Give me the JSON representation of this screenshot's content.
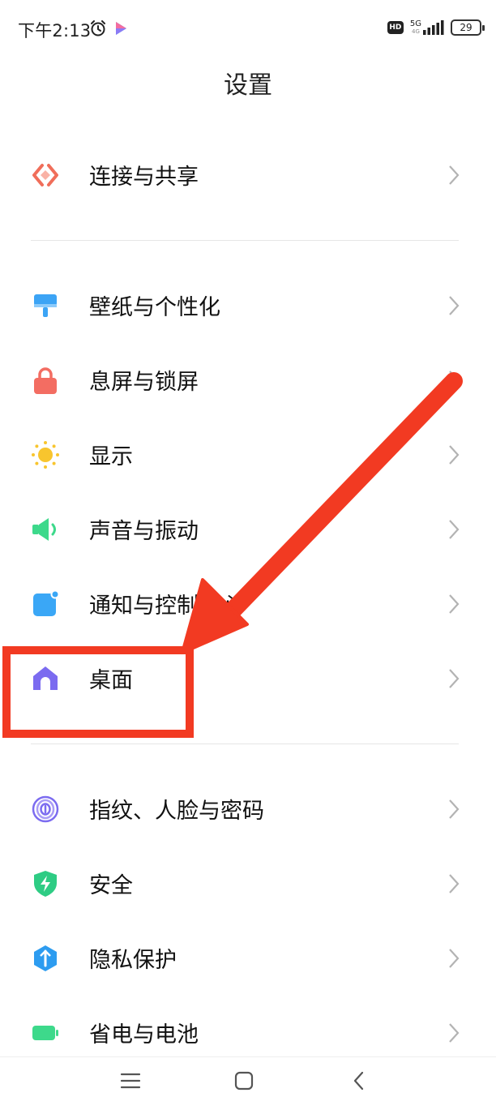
{
  "status_bar": {
    "time": "下午2:13",
    "network_type": "5G",
    "network_sub": "4G",
    "hd_badge": "HD",
    "battery": "29"
  },
  "header": {
    "title": "设置"
  },
  "sections": [
    {
      "items": [
        {
          "label": "连接与共享",
          "icon": "share-connect-icon",
          "color": "#F06E5A"
        }
      ]
    },
    {
      "items": [
        {
          "label": "壁纸与个性化",
          "icon": "wallpaper-brush-icon",
          "color": "#3CA4F5"
        },
        {
          "label": "息屏与锁屏",
          "icon": "lock-icon",
          "color": "#F36D62"
        },
        {
          "label": "显示",
          "icon": "sun-icon",
          "color": "#F8C52E"
        },
        {
          "label": "声音与振动",
          "icon": "speaker-icon",
          "color": "#3DD98B"
        },
        {
          "label": "通知与控制中心",
          "icon": "notification-icon",
          "color": "#3AA7F6"
        },
        {
          "label": "桌面",
          "icon": "home-icon",
          "color": "#7B6BF0"
        }
      ]
    },
    {
      "items": [
        {
          "label": "指纹、人脸与密码",
          "icon": "fingerprint-icon",
          "color": "#7C6CF0"
        },
        {
          "label": "安全",
          "icon": "shield-bolt-icon",
          "color": "#2ECC84"
        },
        {
          "label": "隐私保护",
          "icon": "privacy-icon",
          "color": "#2D9CF0"
        },
        {
          "label": "省电与电池",
          "icon": "battery-icon",
          "color": "#3DD98B"
        }
      ]
    }
  ],
  "annotation": {
    "color": "#F23A22",
    "highlighted_item": "桌面"
  },
  "nav_bar": {
    "buttons": [
      "menu-icon",
      "home-square-icon",
      "back-icon"
    ]
  }
}
